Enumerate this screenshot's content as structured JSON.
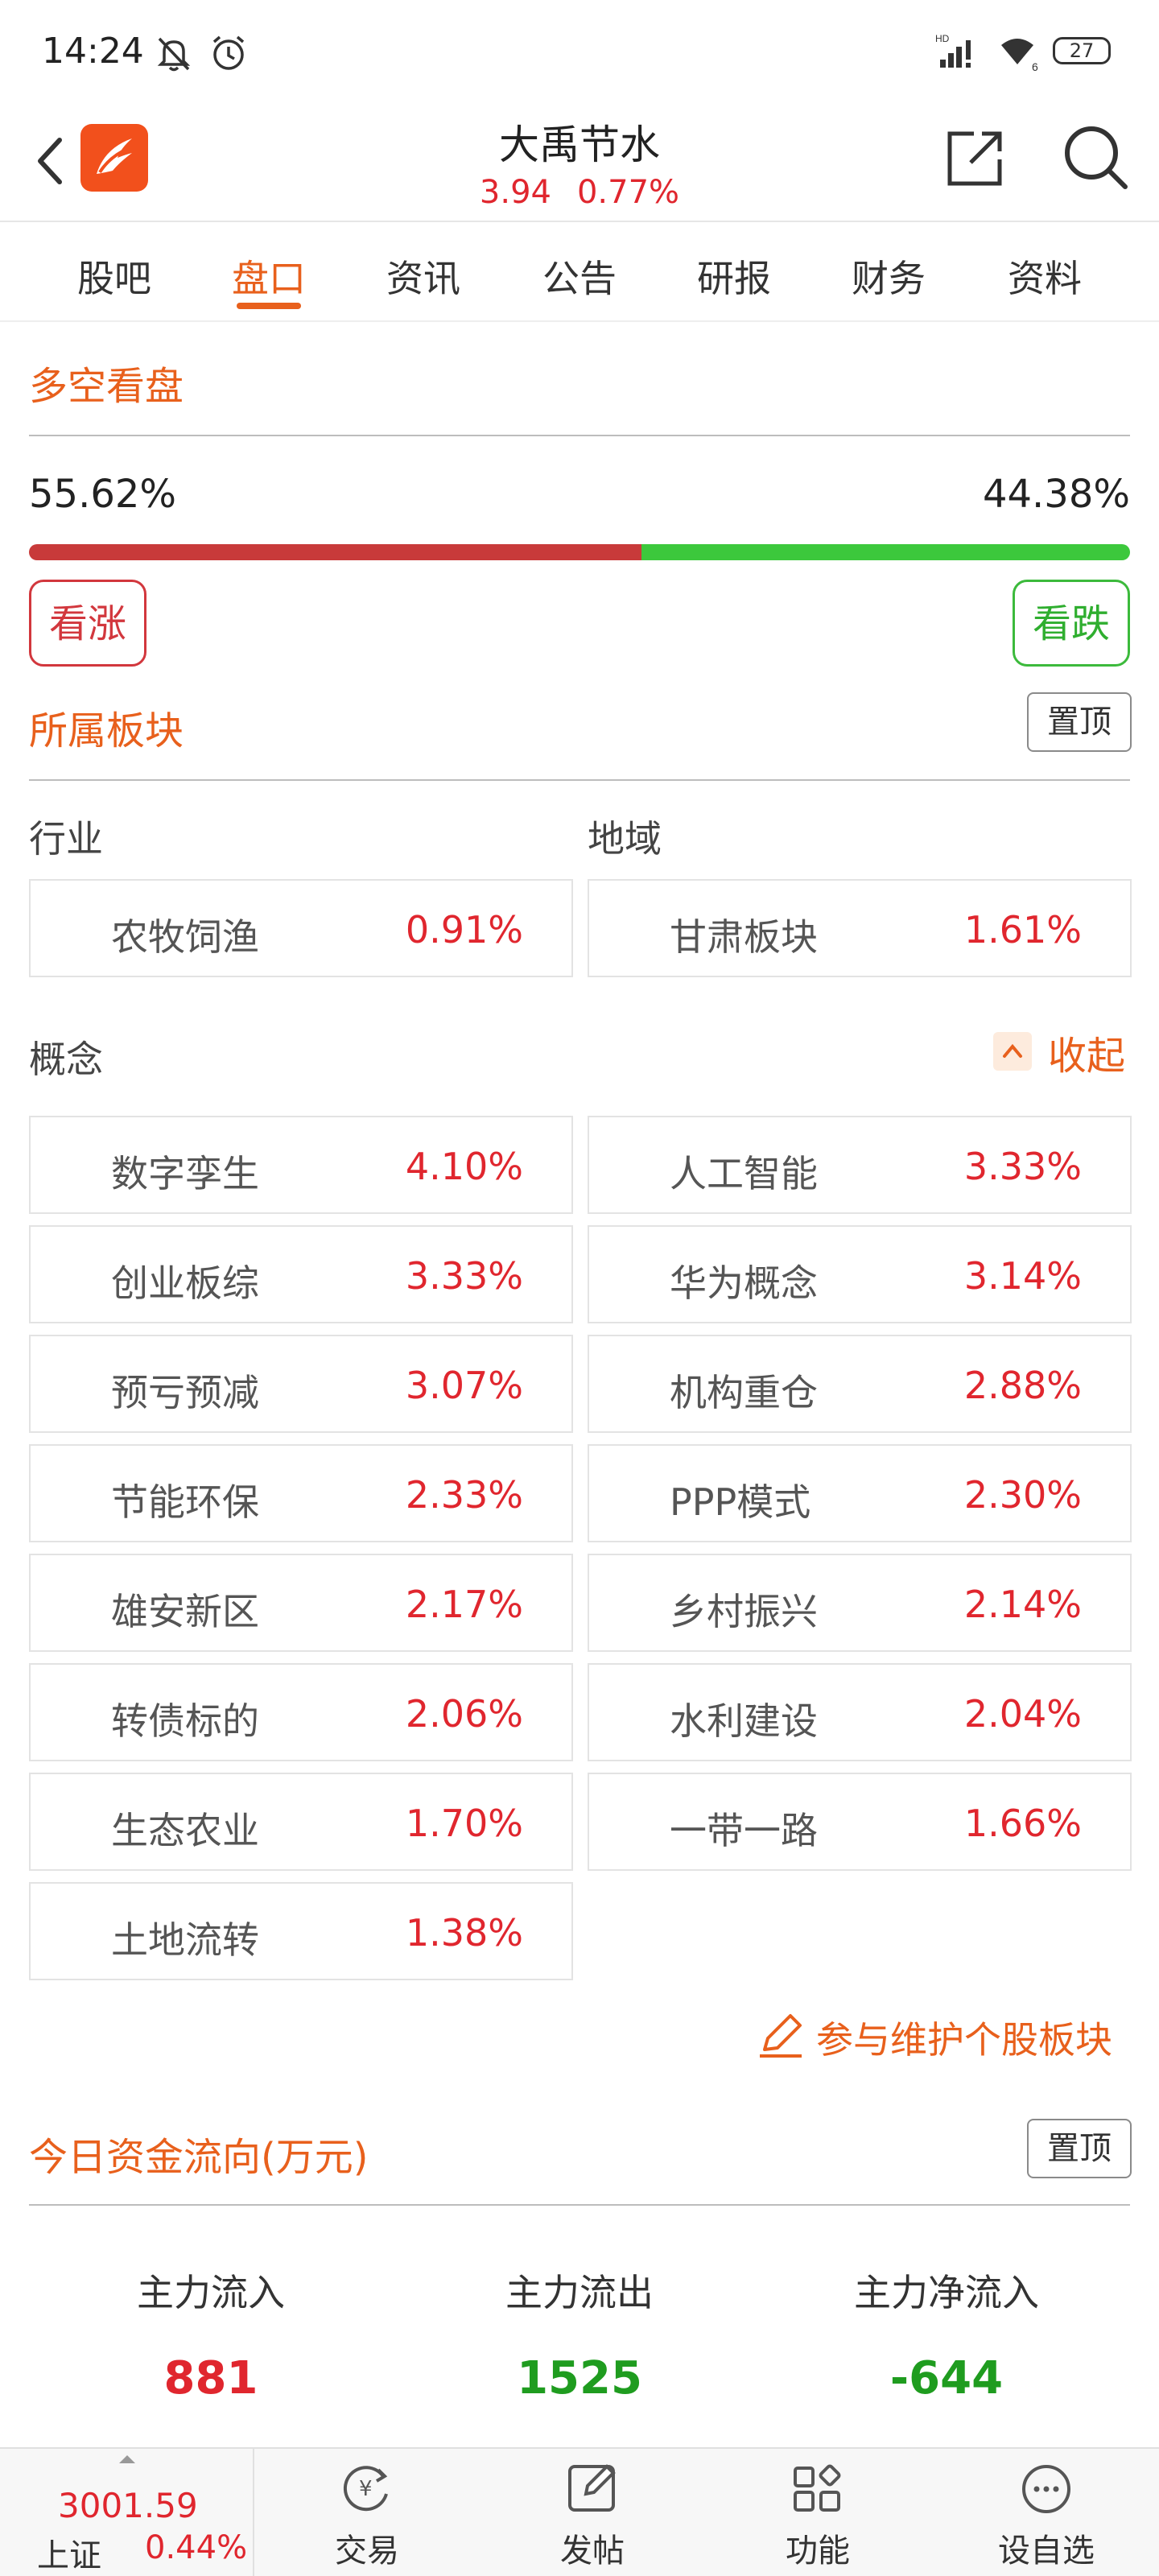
{
  "status_bar": {
    "time": "14:24",
    "battery": "27"
  },
  "header": {
    "stock_name": "大禹节水",
    "price": "3.94",
    "change_pct": "0.77%"
  },
  "tabs": [
    {
      "label": "股吧"
    },
    {
      "label": "盘口"
    },
    {
      "label": "资讯"
    },
    {
      "label": "公告"
    },
    {
      "label": "研报"
    },
    {
      "label": "财务"
    },
    {
      "label": "资料"
    }
  ],
  "active_tab": "盘口",
  "sentiment": {
    "title": "多空看盘",
    "bull_pct": "55.62%",
    "bear_pct": "44.38%",
    "bull_fraction": 0.5562,
    "bull_label": "看涨",
    "bear_label": "看跌"
  },
  "sectors": {
    "title": "所属板块",
    "pin_label": "置顶",
    "industry_label": "行业",
    "region_label": "地域",
    "industry": {
      "name": "农牧饲渔",
      "value": "0.91%"
    },
    "region": {
      "name": "甘肃板块",
      "value": "1.61%"
    },
    "concept_label": "概念",
    "collapse_label": "收起",
    "concepts": [
      {
        "name": "数字孪生",
        "value": "4.10%"
      },
      {
        "name": "人工智能",
        "value": "3.33%"
      },
      {
        "name": "创业板综",
        "value": "3.33%"
      },
      {
        "name": "华为概念",
        "value": "3.14%"
      },
      {
        "name": "预亏预减",
        "value": "3.07%"
      },
      {
        "name": "机构重仓",
        "value": "2.88%"
      },
      {
        "name": "节能环保",
        "value": "2.33%"
      },
      {
        "name": "PPP模式",
        "value": "2.30%"
      },
      {
        "name": "雄安新区",
        "value": "2.17%"
      },
      {
        "name": "乡村振兴",
        "value": "2.14%"
      },
      {
        "name": "转债标的",
        "value": "2.06%"
      },
      {
        "name": "水利建设",
        "value": "2.04%"
      },
      {
        "name": "生态农业",
        "value": "1.70%"
      },
      {
        "name": "一带一路",
        "value": "1.66%"
      },
      {
        "name": "土地流转",
        "value": "1.38%"
      }
    ],
    "maintain_label": "参与维护个股板块"
  },
  "fund_flow": {
    "title": "今日资金流向(万元)",
    "pin_label": "置顶",
    "inflow_label": "主力流入",
    "inflow_value": "881",
    "outflow_label": "主力流出",
    "outflow_value": "1525",
    "net_label": "主力净流入",
    "net_value": "-644",
    "colors": {
      "up": "#e0262e",
      "down": "#1f9c1f"
    }
  },
  "bottom_nav": {
    "index_value": "3001.59",
    "index_name": "上证",
    "index_change": "0.44%",
    "items": [
      {
        "label": "交易",
        "icon": "trade-icon"
      },
      {
        "label": "发帖",
        "icon": "compose-icon"
      },
      {
        "label": "功能",
        "icon": "grid-icon"
      },
      {
        "label": "设自选",
        "icon": "more-icon"
      }
    ]
  },
  "colors": {
    "accent": "#e8601c",
    "red": "#e0262e",
    "green": "#3cc83c"
  }
}
